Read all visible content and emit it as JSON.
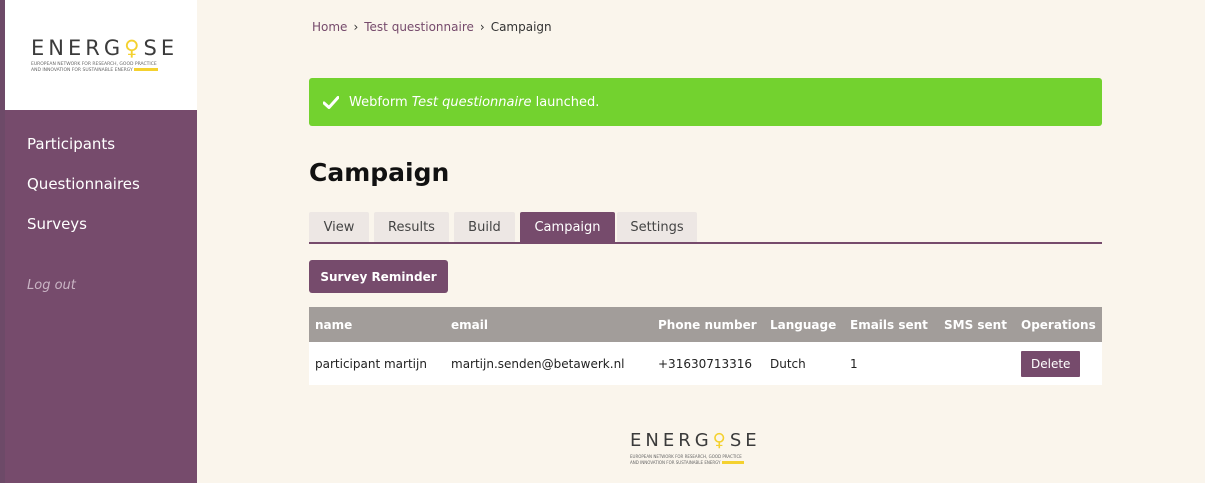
{
  "brand": {
    "word": "ENERGISE",
    "tagline_1": "European network for research, good practice",
    "tagline_2": "and innovation for sustainable energy",
    "accent_color": "#f4d12f"
  },
  "sidebar": {
    "items": [
      {
        "label": "Participants"
      },
      {
        "label": "Questionnaires"
      },
      {
        "label": "Surveys"
      }
    ],
    "logout": "Log out",
    "color": "#764b6c"
  },
  "breadcrumb": {
    "home": "Home",
    "parent": "Test questionnaire",
    "current": "Campaign",
    "separator": "›"
  },
  "alert": {
    "prefix": "Webform ",
    "emphasis": "Test questionnaire",
    "suffix": " launched.",
    "icon": "check-icon",
    "color": "#73d22f"
  },
  "page_title": "Campaign",
  "tabs": [
    {
      "label": "View"
    },
    {
      "label": "Results"
    },
    {
      "label": "Build"
    },
    {
      "label": "Campaign",
      "active": true
    },
    {
      "label": "Settings"
    }
  ],
  "reminder_button": "Survey Reminder",
  "table": {
    "headers": [
      "name",
      "email",
      "Phone number",
      "Language",
      "Emails sent",
      "SMS sent",
      "Operations"
    ],
    "rows": [
      {
        "name": "participant martijn",
        "email": "martijn.senden@betawerk.nl",
        "phone": "+31630713316",
        "language": "Dutch",
        "emails_sent": "1",
        "sms_sent": "",
        "operation": "Delete"
      }
    ]
  }
}
